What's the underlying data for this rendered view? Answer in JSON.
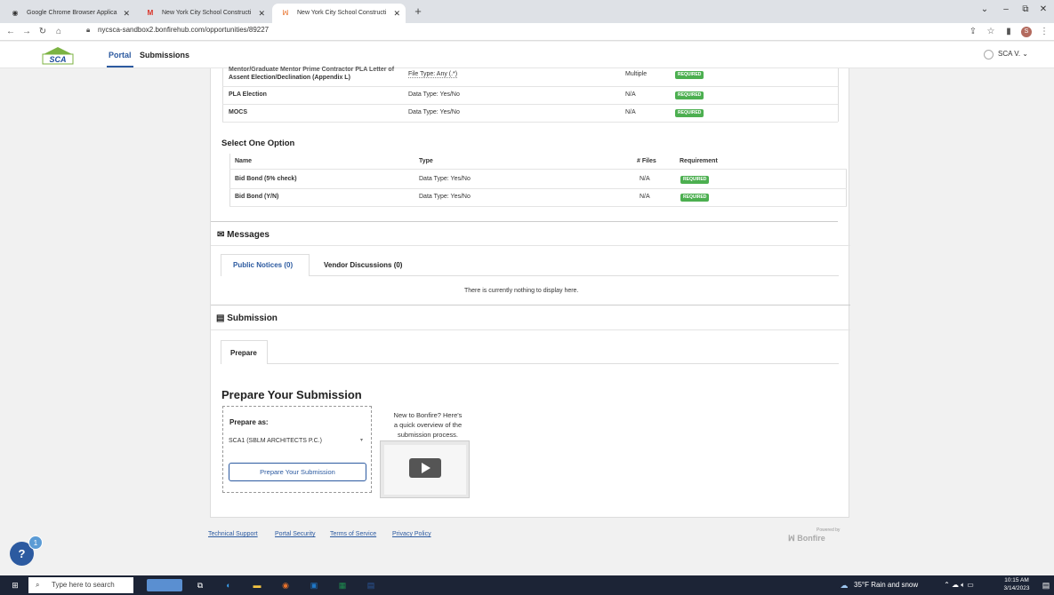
{
  "browser": {
    "tabs": [
      {
        "label": "Google Chrome Browser Applica",
        "favicon": "chrome-icon"
      },
      {
        "label": "New York City School Constructi",
        "favicon": "gmail-icon"
      },
      {
        "label": "New York City School Constructi",
        "favicon": "bonfire-icon"
      }
    ],
    "url": "nycsca-sandbox2.bonfirehub.com/opportunities/89227"
  },
  "header": {
    "logo_text": "SCA",
    "nav": [
      "Portal",
      "Submissions"
    ],
    "user": "SCA V."
  },
  "requirements_top": [
    {
      "name_line1": "Mentor/Graduate Mentor Prime Contractor PLA Letter of",
      "name_line2": "Assent Election/Declination (Appendix L)",
      "type": "File Type: Any (.*)",
      "files": "Multiple",
      "req": "REQUIRED"
    },
    {
      "name_line1": "PLA Election",
      "name_line2": "",
      "type": "Data Type: Yes/No",
      "files": "N/A",
      "req": "REQUIRED"
    },
    {
      "name_line1": "MOCS",
      "name_line2": "",
      "type": "Data Type: Yes/No",
      "files": "N/A",
      "req": "REQUIRED"
    }
  ],
  "select_one": {
    "title": "Select One Option",
    "headers": [
      "Name",
      "Type",
      "# Files",
      "Requirement"
    ],
    "rows": [
      {
        "name": "Bid Bond (5% check)",
        "type": "Data Type: Yes/No",
        "files": "N/A",
        "req": "REQUIRED"
      },
      {
        "name": "Bid Bond (Y/N)",
        "type": "Data Type: Yes/No",
        "files": "N/A",
        "req": "REQUIRED"
      }
    ]
  },
  "messages": {
    "title": "Messages",
    "tabs": [
      "Public Notices (0)",
      "Vendor Discussions (0)"
    ],
    "empty": "There is currently nothing to display here."
  },
  "submission": {
    "title": "Submission",
    "tab": "Prepare",
    "heading": "Prepare Your Submission",
    "prepare_as_label": "Prepare as:",
    "prepare_as_value": "SCA1 (SBLM ARCHITECTS P.C.)",
    "button": "Prepare Your Submission",
    "help_text": [
      "New to Bonfire? Here's",
      "a quick overview of the",
      "submission process."
    ]
  },
  "footer": {
    "links": [
      "Technical Support",
      "Portal Security",
      "Terms of Service",
      "Privacy Policy"
    ],
    "powered_by": "Powered by",
    "brand": "Bonfire"
  },
  "help_badge": {
    "label": "?",
    "count": "1"
  },
  "taskbar": {
    "search_placeholder": "Type here to search",
    "weather": "35°F  Rain and snow",
    "time": "10:15 AM",
    "date": "3/14/2023"
  },
  "colors": {
    "accent": "#2c5aa0",
    "required": "#4caf50",
    "taskbar": "#1c2436"
  }
}
